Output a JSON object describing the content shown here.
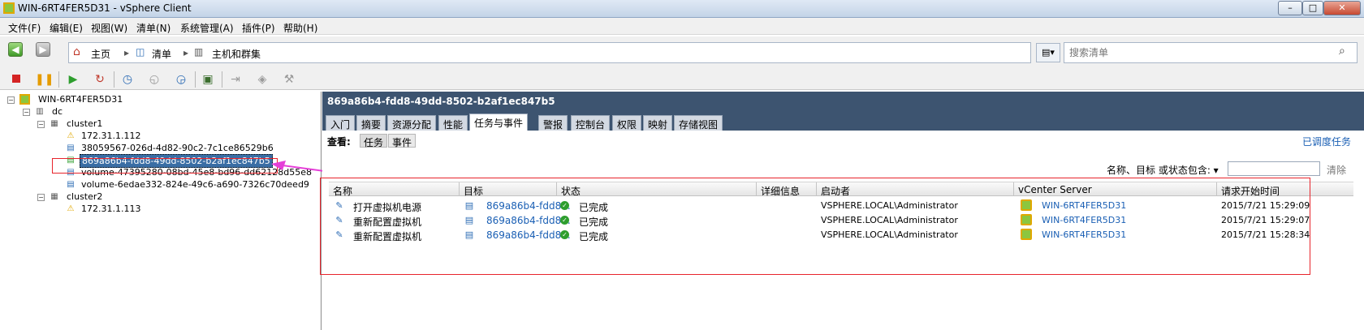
{
  "window": {
    "title": "WIN-6RT4FER5D31 - vSphere Client",
    "controls": [
      "–",
      "□",
      "✕"
    ]
  },
  "menu": [
    "文件(F)",
    "编辑(E)",
    "视图(W)",
    "清单(N)",
    "系统管理(A)",
    "插件(P)",
    "帮助(H)"
  ],
  "breadcrumb": {
    "home": "主页",
    "inventory": "清单",
    "hosts": "主机和群集"
  },
  "search": {
    "placeholder": "搜索清单"
  },
  "tree": {
    "root": "WIN-6RT4FER5D31",
    "dc": "dc",
    "cluster1": "cluster1",
    "host1": "172.31.1.112",
    "vm1": "38059567-026d-4d82-90c2-7c1ce86529b6",
    "vm2": "869a86b4-fdd8-49dd-8502-b2af1ec847b5",
    "vm3": "volume-47395280-08bd-45e8-bd96-dd62128d55e8",
    "vm4": "volume-6edae332-824e-49c6-a690-7326c70deed9",
    "cluster2": "cluster2",
    "host2": "172.31.1.113"
  },
  "detail": {
    "title": "869a86b4-fdd8-49dd-8502-b2af1ec847b5",
    "tabs": [
      "入门",
      "摘要",
      "资源分配",
      "性能",
      "任务与事件",
      "警报",
      "控制台",
      "权限",
      "映射",
      "存储视图"
    ],
    "active_tab": "任务与事件",
    "view_label": "查看:",
    "view_tasks": "任务",
    "view_events": "事件",
    "scheduled_link": "已调度任务",
    "filter_label": "名称、目标 或状态包含: ▾",
    "clear": "清除",
    "columns": [
      "名称",
      "目标",
      "状态",
      "详细信息",
      "启动者",
      "vCenter Server",
      "请求开始时间"
    ],
    "rows": [
      {
        "name": "打开虚拟机电源",
        "target": "869a86b4-fdd8...",
        "status": "已完成",
        "details": "",
        "initiator": "VSPHERE.LOCAL\\Administrator",
        "vcenter": "WIN-6RT4FER5D31",
        "time": "2015/7/21 15:29:09"
      },
      {
        "name": "重新配置虚拟机",
        "target": "869a86b4-fdd8...",
        "status": "已完成",
        "details": "",
        "initiator": "VSPHERE.LOCAL\\Administrator",
        "vcenter": "WIN-6RT4FER5D31",
        "time": "2015/7/21 15:29:07"
      },
      {
        "name": "重新配置虚拟机",
        "target": "869a86b4-fdd8...",
        "status": "已完成",
        "details": "",
        "initiator": "VSPHERE.LOCAL\\Administrator",
        "vcenter": "WIN-6RT4FER5D31",
        "time": "2015/7/21 15:28:34"
      }
    ]
  },
  "colors": {
    "header_bg": "#3d5470",
    "annotation": "#e8242c",
    "link": "#1a5fb4",
    "success": "#2e9e2e"
  }
}
